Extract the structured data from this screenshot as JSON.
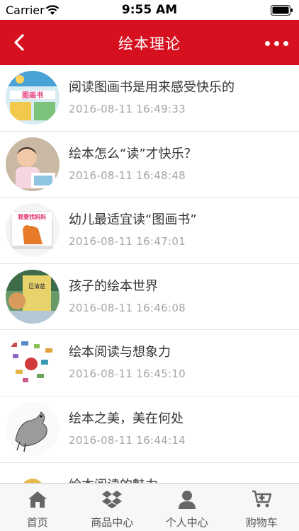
{
  "status_bar": {
    "carrier": "Carrier",
    "time": "9:55 AM"
  },
  "header": {
    "title": "绘本理论",
    "back_icon": "chevron-left-icon",
    "more_icon": "more-dots-icon",
    "color": "#d7101f"
  },
  "articles": [
    {
      "title": "阅读图画书是用来感受快乐的",
      "date": "2016-08-11 16:49:33"
    },
    {
      "title": "绘本怎么“读”才快乐？",
      "date": "2016-08-11 16:48:48"
    },
    {
      "title": "幼儿最适宜读“图画书”",
      "date": "2016-08-11 16:47:01"
    },
    {
      "title": "孩子的绘本世界",
      "date": "2016-08-11 16:46:08"
    },
    {
      "title": "绘本阅读与想象力",
      "date": "2016-08-11 16:45:10"
    },
    {
      "title": "绘本之美，美在何处",
      "date": "2016-08-11 16:44:14"
    },
    {
      "title": "绘本阅读的魅力",
      "date": ""
    }
  ],
  "tabbar": {
    "tabs": [
      {
        "label": "首页",
        "icon": "home-icon"
      },
      {
        "label": "商品中心",
        "icon": "dropbox-icon"
      },
      {
        "label": "个人中心",
        "icon": "user-icon"
      },
      {
        "label": "购物车",
        "icon": "cart-icon"
      }
    ]
  }
}
